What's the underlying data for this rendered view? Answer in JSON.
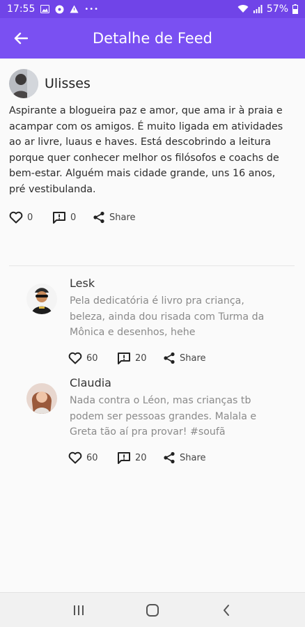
{
  "status_bar": {
    "time": "17:55",
    "more": "•••",
    "battery": "57%"
  },
  "app_bar": {
    "title": "Detalhe de Feed"
  },
  "post": {
    "author": "Ulisses",
    "body": "Aspirante a blogueira paz e amor, que ama ir à praia e acampar com os amigos. É muito ligada em atividades ao ar livre, luaus e haves. Está descobrindo a leitura porque quer conhecer melhor os filósofos e coachs de bem-estar. Alguém mais cidade grande, uns 16 anos, pré vestibulanda.",
    "likes": "0",
    "comments": "0",
    "share_label": "Share"
  },
  "comments": [
    {
      "author": "Lesk",
      "text": "Pela dedicatória é livro pra criança, beleza, ainda dou risada com Turma da Mônica e desenhos, hehe",
      "likes": "60",
      "comments": "20",
      "share_label": "Share"
    },
    {
      "author": "Claudia",
      "text": "Nada contra o Léon, mas crianças tb podem ser pessoas grandes. Malala e Greta tão aí pra provar! #soufã",
      "likes": "60",
      "comments": "20",
      "share_label": "Share"
    }
  ],
  "colors": {
    "accent": "#7a50f2",
    "status_bar": "#7044e8"
  },
  "icons": [
    "back-arrow-icon",
    "heart-icon",
    "comment-icon",
    "share-icon",
    "wifi-icon",
    "signal-icon",
    "battery-icon",
    "recents-icon",
    "home-icon",
    "back-icon"
  ]
}
